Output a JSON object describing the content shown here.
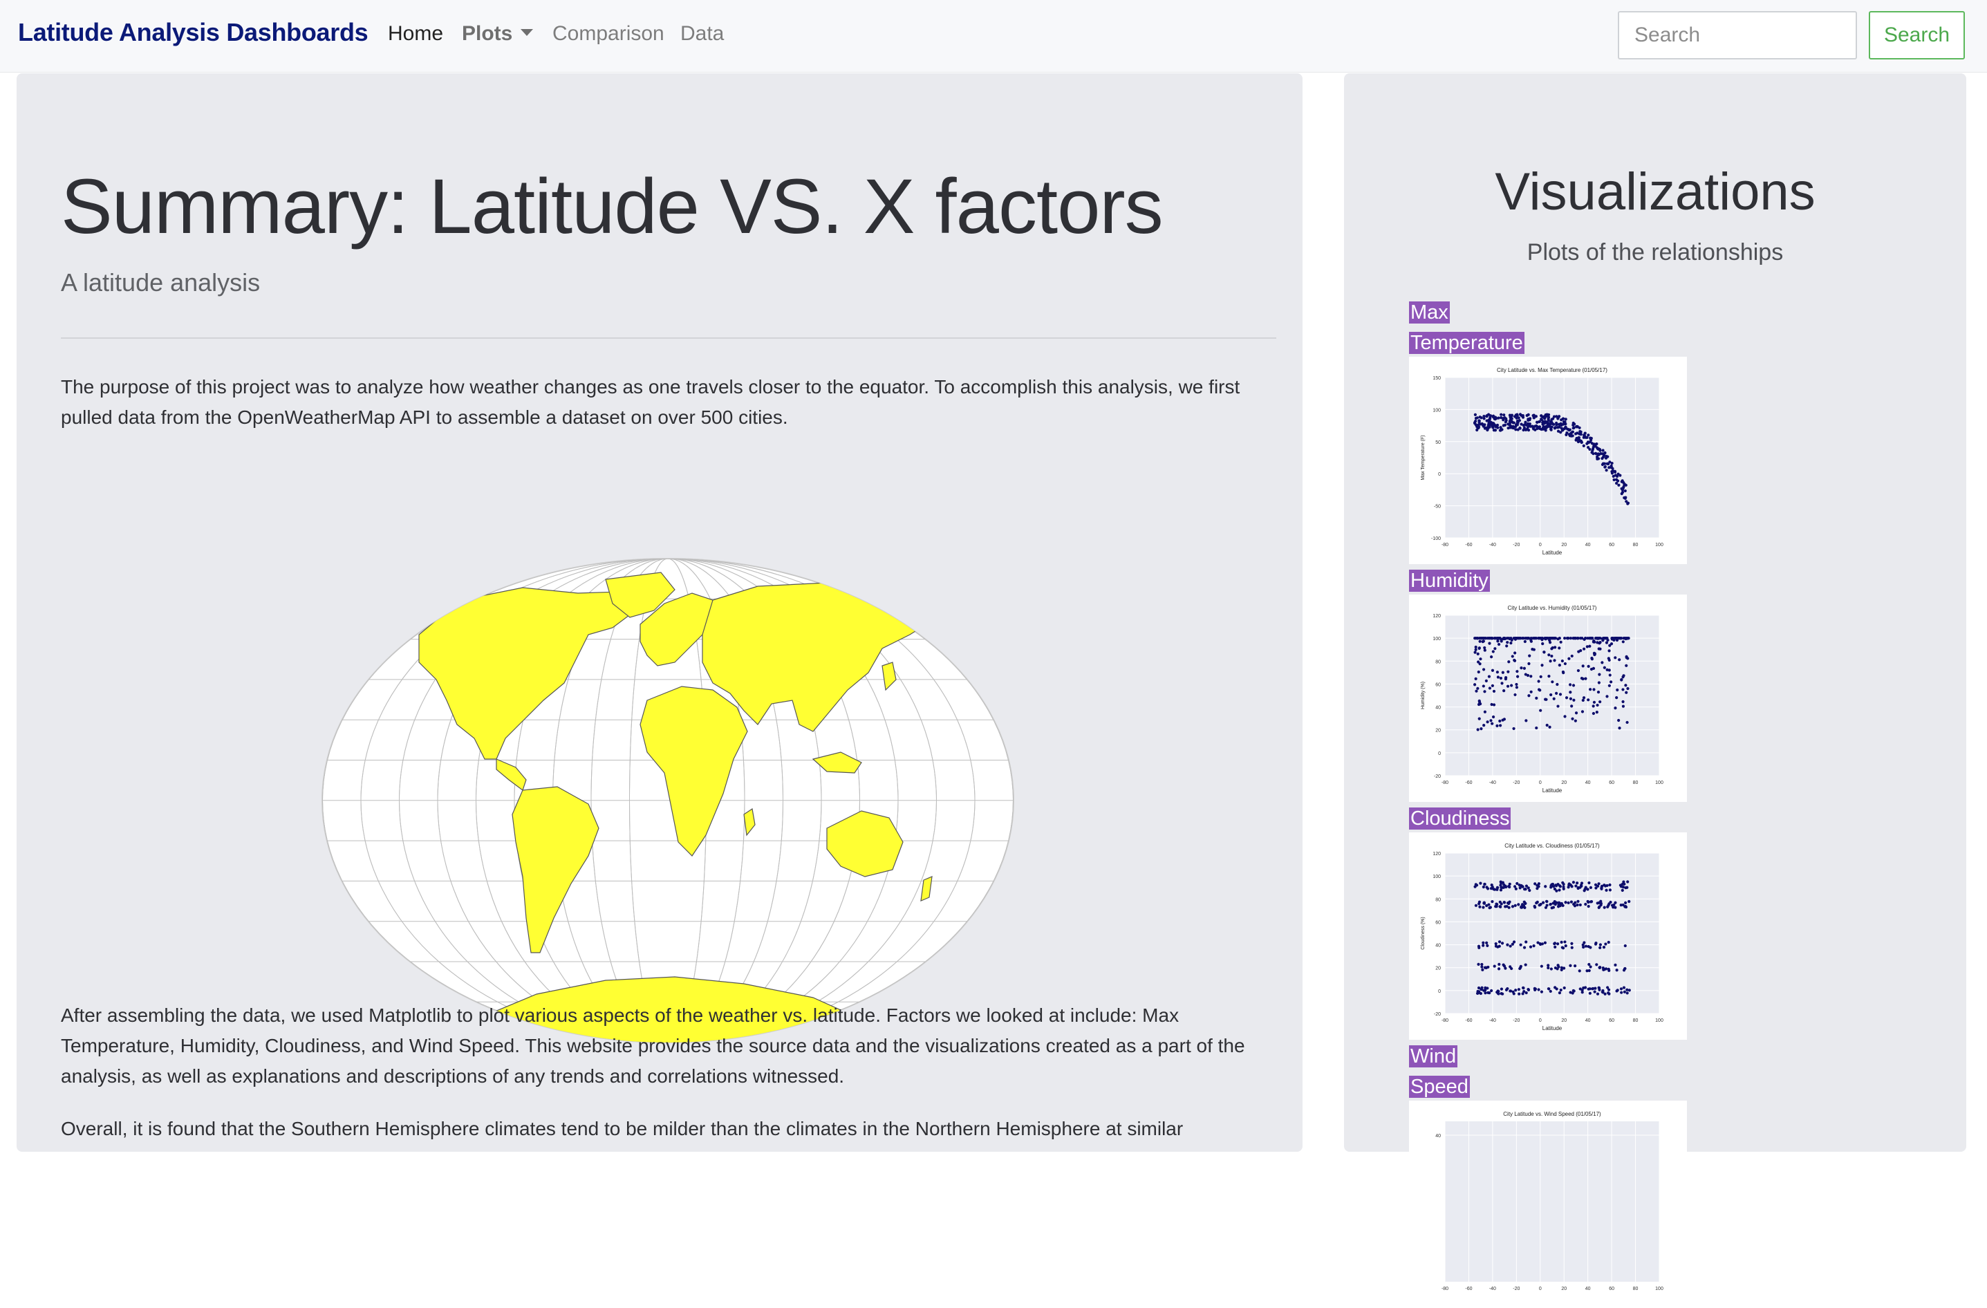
{
  "navbar": {
    "brand": "Latitude Analysis Dashboards",
    "links": {
      "home": "Home",
      "plots": "Plots",
      "comparison": "Comparison",
      "data": "Data"
    },
    "search_placeholder": "Search",
    "search_button": "Search",
    "colors": {
      "brand": "#0b1a78",
      "search_button": "#4ca84c"
    }
  },
  "main": {
    "title": "Summary: Latitude VS. X factors",
    "lead": "A latitude analysis",
    "paragraphs": [
      "The purpose of this project was to analyze how weather changes as one travels closer to the equator. To accomplish this analysis, we first pulled data from the OpenWeatherMap API to assemble a dataset on over 500 cities.",
      "After assembling the data, we used Matplotlib to plot various aspects of the weather vs. latitude. Factors we looked at include: Max Temperature, Humidity, Cloudiness, and Wind Speed. This website provides the source data and the visualizations created as a part of the analysis, as well as explanations and descriptions of any trends and correlations witnessed.",
      "Overall, it is found that the Southern Hemisphere climates tend to be milder than the climates in the Northern Hemisphere at similar"
    ],
    "map": {
      "icon": "world-map-image",
      "land_color": "#ffff33"
    }
  },
  "sidebar": {
    "title": "Visualizations",
    "lead": "Plots of the relationships",
    "label_color": "#8e55b8",
    "plots": [
      {
        "label_words": [
          "Max",
          "Temperature"
        ],
        "plot_title": "City Latitude vs. Max Temperature (01/05/17)",
        "ylabel": "Max Temperature (F)",
        "yticks": [
          "150",
          "100",
          "50",
          "0",
          "-50",
          "-100"
        ]
      },
      {
        "label_words": [
          "Humidity"
        ],
        "plot_title": "City Latitude vs. Humidity (01/05/17)",
        "ylabel": "Humidity (%)",
        "yticks": [
          "120",
          "100",
          "80",
          "60",
          "40",
          "20",
          "0",
          "-20"
        ]
      },
      {
        "label_words": [
          "Cloudiness"
        ],
        "plot_title": "City Latitude vs. Cloudiness (01/05/17)",
        "ylabel": "Cloudiness (%)",
        "yticks": [
          "120",
          "100",
          "80",
          "60",
          "40",
          "20",
          "0",
          "-20"
        ]
      },
      {
        "label_words": [
          "Wind",
          "Speed"
        ],
        "plot_title": "City Latitude vs. Wind Speed (01/05/17)",
        "ylabel": "",
        "yticks": [
          "40"
        ]
      }
    ],
    "xlabel": "Latitude",
    "xticks": [
      "-80",
      "-60",
      "-40",
      "-20",
      "0",
      "20",
      "40",
      "60",
      "80",
      "100"
    ],
    "point_color": "#0d0d6b"
  }
}
